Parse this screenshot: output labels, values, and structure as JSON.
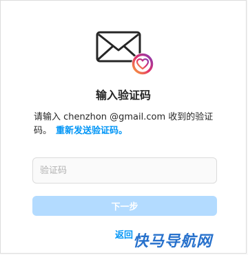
{
  "title": "输入验证码",
  "description": {
    "text": "请输入 chenzhon @gmail.com 收到的验证码。",
    "resend_link": "重新发送验证码。"
  },
  "code_input": {
    "placeholder": "验证码",
    "value": ""
  },
  "next_button": "下一步",
  "back_link": "返回",
  "watermark": "快马导航网",
  "colors": {
    "accent": "#0095f6",
    "button_disabled": "#b3dbff",
    "heart_gradient": [
      "#f9a13a",
      "#e1306c",
      "#833ab4"
    ]
  },
  "icons": {
    "hero": "envelope-with-heart-icon"
  }
}
